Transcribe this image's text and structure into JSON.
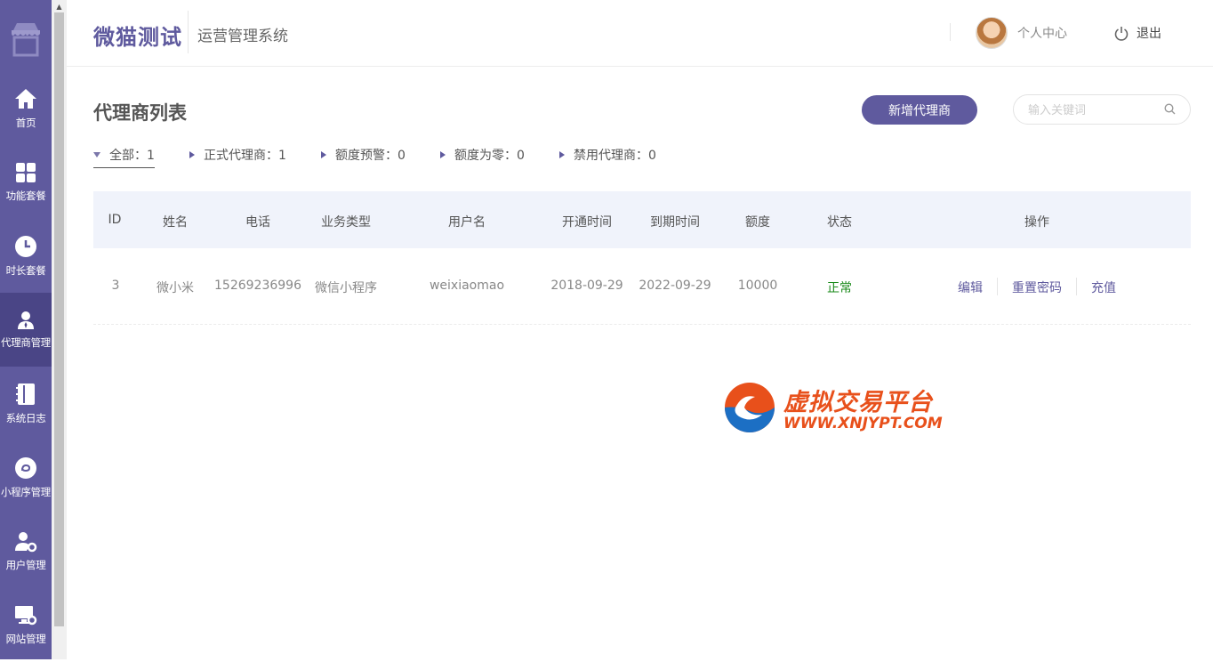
{
  "app": {
    "brand": "微猫测试",
    "system_name": "运营管理系统",
    "user_center": "个人中心",
    "logout": "退出"
  },
  "sidebar": {
    "logo_icon": "store-icon",
    "items": [
      {
        "label": "首页",
        "icon": "home-icon"
      },
      {
        "label": "功能套餐",
        "icon": "grid-icon"
      },
      {
        "label": "时长套餐",
        "icon": "clock-icon"
      },
      {
        "label": "代理商管理",
        "icon": "agent-icon",
        "active": true
      },
      {
        "label": "系统日志",
        "icon": "notebook-icon"
      },
      {
        "label": "小程序管理",
        "icon": "miniprogram-icon"
      },
      {
        "label": "用户管理",
        "icon": "user-gear-icon"
      },
      {
        "label": "网站管理",
        "icon": "monitor-gear-icon"
      }
    ]
  },
  "page": {
    "title": "代理商列表",
    "add_button": "新增代理商",
    "search_placeholder": "输入关键词"
  },
  "filters": [
    {
      "label": "全部：1",
      "active": true
    },
    {
      "label": "正式代理商：1"
    },
    {
      "label": "额度预警：0"
    },
    {
      "label": "额度为零：0"
    },
    {
      "label": "禁用代理商：0"
    }
  ],
  "table": {
    "headers": [
      "ID",
      "姓名",
      "电话",
      "业务类型",
      "用户名",
      "开通时间",
      "到期时间",
      "额度",
      "状态",
      "操作"
    ],
    "rows": [
      {
        "id": "3",
        "name": "微小米",
        "phone": "15269236996",
        "business_type": "微信小程序",
        "username": "weixiaomao",
        "open_time": "2018-09-29",
        "expire_time": "2022-09-29",
        "quota": "10000",
        "status": "正常",
        "ops": [
          "编辑",
          "重置密码",
          "充值"
        ]
      }
    ]
  },
  "watermark": {
    "title": "虚拟交易平台",
    "url": "WWW.XNJYPT.COM"
  },
  "colors": {
    "primary": "#5f5a9e",
    "sidebar_active": "#4a4586",
    "status_ok": "#1a8a1a",
    "watermark": "#e8501b"
  }
}
